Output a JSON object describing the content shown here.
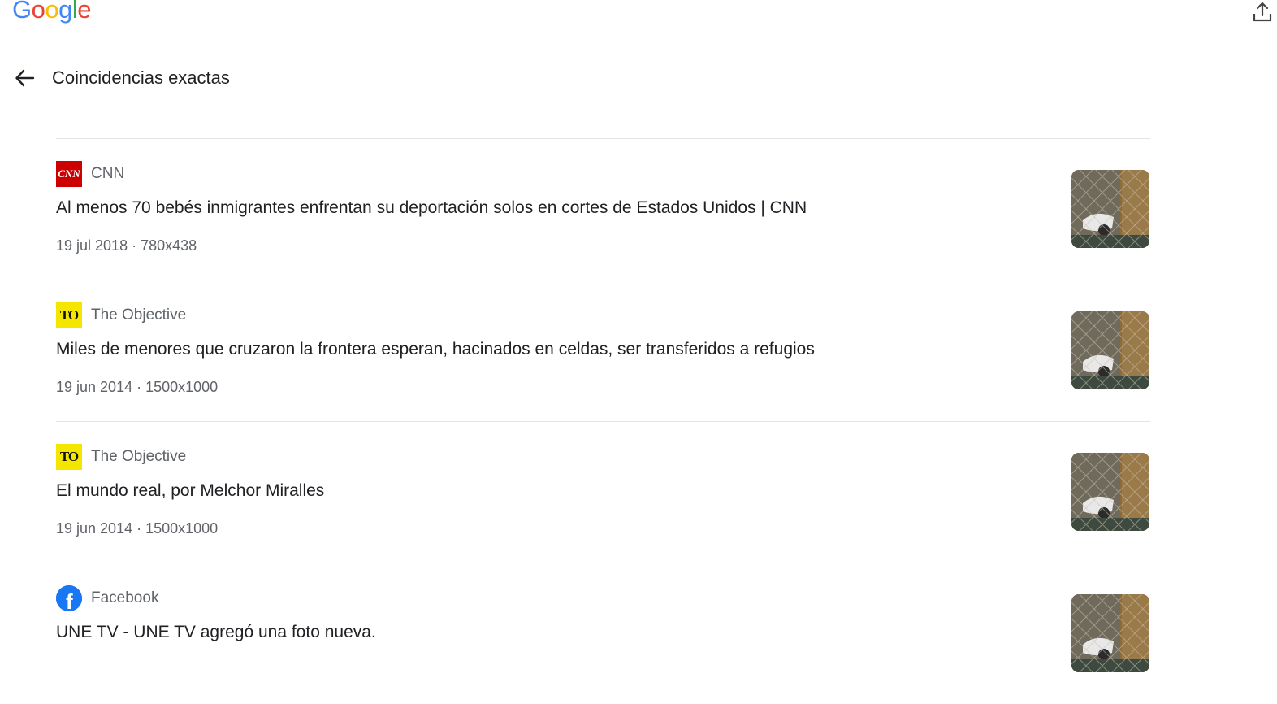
{
  "brand": {
    "logo_letters": [
      "G",
      "o",
      "o",
      "g",
      "l",
      "e"
    ],
    "logo_colors": [
      "#4285F4",
      "#EA4335",
      "#FBBC05",
      "#4285F4",
      "#34A853",
      "#EA4335"
    ]
  },
  "toolbar": {
    "share_icon": "upload-share-icon"
  },
  "header": {
    "back_icon": "arrow-left-icon",
    "title": "Coincidencias exactas"
  },
  "results": [
    {
      "favicon": "cnn-favicon",
      "favicon_text": "CNN",
      "source": "CNN",
      "headline": "Al menos 70 bebés inmigrantes enfrentan su deportación solos en cortes de Estados Unidos | CNN",
      "meta": "19 jul 2018 · 780x438"
    },
    {
      "favicon": "the-objective-favicon",
      "favicon_text": "TO",
      "source": "The Objective",
      "headline": "Miles de menores que cruzaron la frontera esperan, hacinados en celdas, ser transferidos a refugios",
      "meta": "19 jun 2014 · 1500x1000"
    },
    {
      "favicon": "the-objective-favicon",
      "favicon_text": "TO",
      "source": "The Objective",
      "headline": "El mundo real, por Melchor Miralles",
      "meta": "19 jun 2014 · 1500x1000"
    },
    {
      "favicon": "facebook-favicon",
      "favicon_text": "f",
      "source": "Facebook",
      "headline": "UNE TV - UNE TV agregó una foto nueva.",
      "meta": ""
    }
  ]
}
